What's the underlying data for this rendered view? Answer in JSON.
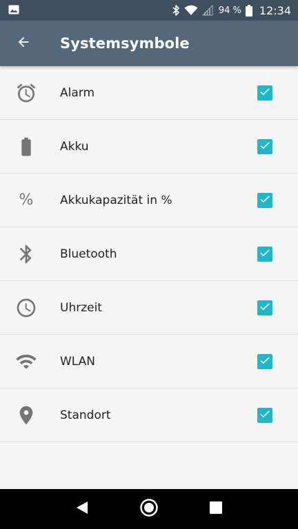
{
  "status_bar": {
    "battery_percent": "94 %",
    "time": "12:34"
  },
  "app_bar": {
    "title": "Systemsymbole"
  },
  "items": [
    {
      "label": "Alarm",
      "icon": "alarm-icon",
      "checked": true
    },
    {
      "label": "Akku",
      "icon": "battery-icon",
      "checked": true
    },
    {
      "label": "Akkukapazität in %",
      "icon": "percent-icon",
      "checked": true
    },
    {
      "label": "Bluetooth",
      "icon": "bluetooth-icon",
      "checked": true
    },
    {
      "label": "Uhrzeit",
      "icon": "clock-icon",
      "checked": true
    },
    {
      "label": "WLAN",
      "icon": "wifi-icon",
      "checked": true
    },
    {
      "label": "Standort",
      "icon": "location-icon",
      "checked": true
    }
  ],
  "colors": {
    "status_bar": "#3f4f5d",
    "app_bar": "#546879",
    "checkbox_accent": "#20b8c8",
    "icon_gray": "#757575",
    "background": "#f5f5f5"
  }
}
